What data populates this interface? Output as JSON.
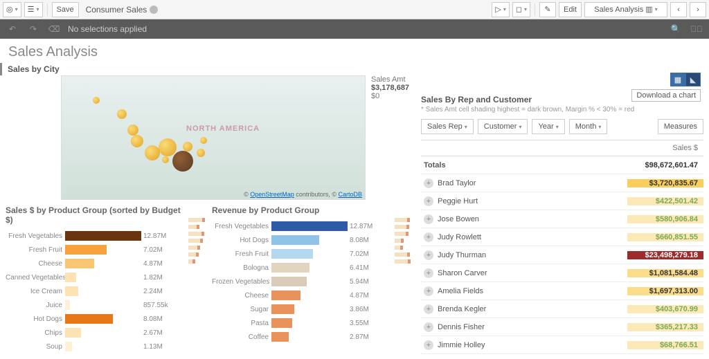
{
  "toolbar": {
    "save": "Save",
    "app_name": "Consumer Sales",
    "edit": "Edit",
    "sheet_btn": "Sales Analysis"
  },
  "selbar": {
    "text": "No selections applied"
  },
  "sheet_title": "Sales Analysis",
  "map": {
    "title": "Sales by City",
    "legend_label": "Sales Amt",
    "legend_max": "$3,178,687",
    "legend_min": "$0",
    "na": "NORTH AMERICA",
    "attrib_pre": "© ",
    "osm": "OpenStreetMap",
    "attrib_mid": " contributors, © ",
    "carto": "CartoDB"
  },
  "chart_data": [
    {
      "type": "bar",
      "title": "Sales $ by Product Group (sorted by Budget $)",
      "categories": [
        "Fresh Vegetables",
        "Fresh Fruit",
        "Cheese",
        "Canned Vegetables",
        "Ice Cream",
        "Juice",
        "Hot Dogs",
        "Chips",
        "Soup"
      ],
      "values_label": [
        "12.87M",
        "7.02M",
        "4.87M",
        "1.82M",
        "2.24M",
        "857.55k",
        "8.08M",
        "2.67M",
        "1.13M"
      ],
      "values": [
        12.87,
        7.02,
        4.87,
        1.82,
        2.24,
        0.86,
        8.08,
        2.67,
        1.13
      ],
      "colors": [
        "#6b3410",
        "#f7a13d",
        "#f9c774",
        "#fde2b3",
        "#fde2b3",
        "#fef0d6",
        "#e67817",
        "#fde2b3",
        "#fef0d6"
      ]
    },
    {
      "type": "bar",
      "title": "Revenue by Product Group",
      "categories": [
        "Fresh Vegetables",
        "Hot Dogs",
        "Fresh Fruit",
        "Bologna",
        "Frozen Vegetables",
        "Cheese",
        "Sugar",
        "Pasta",
        "Coffee"
      ],
      "values_label": [
        "12.87M",
        "8.08M",
        "7.02M",
        "6.41M",
        "5.94M",
        "4.87M",
        "3.86M",
        "3.55M",
        "2.87M"
      ],
      "values": [
        12.87,
        8.08,
        7.02,
        6.41,
        5.94,
        4.87,
        3.86,
        3.55,
        2.87
      ],
      "colors": [
        "#2e5aa8",
        "#8fc3e8",
        "#b6d8ef",
        "#e2d5c0",
        "#d8ccb8",
        "#e8915a",
        "#e8915a",
        "#e8915a",
        "#e8915a"
      ]
    }
  ],
  "pivot": {
    "title": "Sales By Rep and Customer",
    "subtitle": "* Sales Amt cell shading highest = dark brown, Margin % < 30% = red",
    "dims": [
      "Sales Rep",
      "Customer",
      "Year",
      "Month"
    ],
    "measures_btn": "Measures",
    "col_header": "Sales $",
    "totals_label": "Totals",
    "totals_value": "$98,672,601.47",
    "rows": [
      {
        "name": "Brad Taylor",
        "value": "$3,720,835.67",
        "heat": "heat-2"
      },
      {
        "name": "Peggie Hurt",
        "value": "$422,501.42",
        "heat": "heat-0"
      },
      {
        "name": "Jose Bowen",
        "value": "$580,906.84",
        "heat": "heat-0"
      },
      {
        "name": "Judy Rowlett",
        "value": "$660,851.55",
        "heat": "heat-0"
      },
      {
        "name": "Judy Thurman",
        "value": "$23,498,279.18",
        "heat": "heat-red"
      },
      {
        "name": "Sharon Carver",
        "value": "$1,081,584.48",
        "heat": "heat-1"
      },
      {
        "name": "Amelia Fields",
        "value": "$1,697,313.00",
        "heat": "heat-1"
      },
      {
        "name": "Brenda Kegler",
        "value": "$403,670.99",
        "heat": "heat-0"
      },
      {
        "name": "Dennis Fisher",
        "value": "$365,217.33",
        "heat": "heat-0"
      },
      {
        "name": "Jimmie Holley",
        "value": "$68,766.51",
        "heat": "heat-0"
      }
    ]
  },
  "tooltip": "Download a chart"
}
